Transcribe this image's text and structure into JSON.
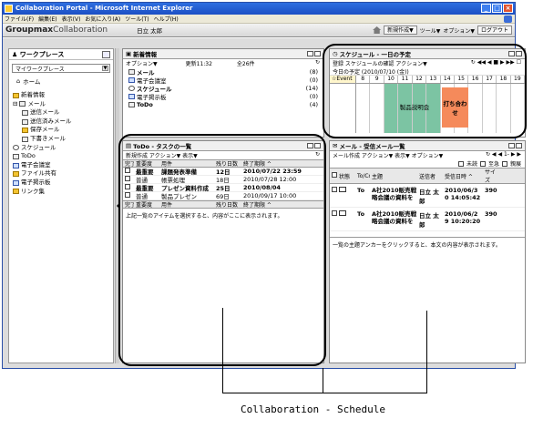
{
  "window": {
    "title": "Collaboration Portal - Microsoft Internet Explorer"
  },
  "menubar": {
    "items": [
      "ファイル(F)",
      "編集(E)",
      "表示(V)",
      "お気に入り(A)",
      "ツール(T)",
      "ヘルプ(H)"
    ]
  },
  "app": {
    "brand": "Groupmax",
    "brand_sub": "Collaboration",
    "username": "日立 太郎",
    "new_button": "新規作成▼",
    "tools_button": "ツール▼",
    "options_button": "オプション▼",
    "logout_button": "ログアウト"
  },
  "left": {
    "title": "ワークプレース",
    "select_value": "マイワークプレース",
    "home": "ホーム",
    "tree": [
      "新着情報",
      "メール",
      "送信メール",
      "送信済みメール",
      "保存メール",
      "下書きメール",
      "スケジュール",
      "ToDo",
      "電子会議室",
      "ファイル共有",
      "電子掲示板",
      "リンク集"
    ]
  },
  "news": {
    "title": "新着情報",
    "toolbar_options": "オプション▼",
    "updated": "更新11:32",
    "total": "全26件",
    "rows": [
      {
        "label": "メール",
        "count": "(8)"
      },
      {
        "label": "電子会議室",
        "count": "(0)"
      },
      {
        "label": "スケジュール",
        "count": "(14)"
      },
      {
        "label": "電子掲示板",
        "count": "(0)"
      },
      {
        "label": "ToDo",
        "count": "(4)"
      }
    ]
  },
  "schedule": {
    "title": "スケジュール - 一日の予定",
    "toolbar": "登録 スケジュールの確認 アクション▼",
    "date": "今日の予定 (2010/07/10 (金))",
    "event_label": "Event",
    "hours": [
      "8",
      "9",
      "10",
      "11",
      "12",
      "13",
      "14",
      "15",
      "16",
      "17",
      "18",
      "19"
    ],
    "events": [
      {
        "label": "製品説明会",
        "color": "#7cc4a3"
      },
      {
        "label": "打ち合わせ",
        "color": "#f58a5b"
      }
    ]
  },
  "todo": {
    "title": "ToDo - タスクの一覧",
    "toolbar": "新規作成 アクション▼ 表示▼",
    "headers": [
      "完了",
      "重要度",
      "用件",
      "残り日数",
      "終了期限 ^"
    ],
    "rows": [
      {
        "priority": "最重要",
        "subject": "課題発表準備",
        "days": "12日",
        "due": "2010/07/22 23:59",
        "bold": true
      },
      {
        "priority": "普通",
        "subject": "帳票処理",
        "days": "18日",
        "due": "2010/07/28 12:00",
        "bold": false
      },
      {
        "priority": "最重要",
        "subject": "プレゼン資料作成",
        "days": "25日",
        "due": "2010/08/04",
        "bold": true
      },
      {
        "priority": "普通",
        "subject": "製品プレゼン",
        "days": "69日",
        "due": "2010/09/17 10:00",
        "bold": false
      }
    ],
    "footer": "上記一覧のアイテムを選択すると、内容がここに表示されます。"
  },
  "mail": {
    "title": "メール - 受信メール一覧",
    "toolbar": "メール作成 アクション▼ 表示▼ オプション▼",
    "filters": [
      "未読",
      "至急",
      "親展"
    ],
    "pager": "1-",
    "headers": [
      "状態",
      "To/Cc",
      "主題",
      "送信者",
      "受信日時 ^",
      "サイズ"
    ],
    "rows": [
      {
        "to": "To",
        "subject": "A社2010販売戦略会議の資料を",
        "sender": "日立 太郎",
        "date": "2010/06/3 0 14:05:42",
        "size": "390"
      },
      {
        "to": "To",
        "subject": "A社2010販売戦略会議の資料を",
        "sender": "日立 太郎",
        "date": "2010/06/2 9 10:20:20",
        "size": "390"
      }
    ],
    "footer": "一覧の主題アンカーをクリックすると、本文の内容が表示されます。"
  },
  "callout": {
    "label": "Collaboration - Schedule"
  }
}
